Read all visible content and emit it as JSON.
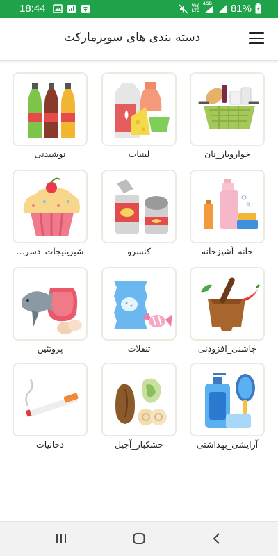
{
  "status_bar": {
    "time": "18:44",
    "battery": "81%",
    "left_icons": [
      "image-icon",
      "signal-icon",
      "wifi-icon"
    ],
    "right_icons": [
      "mute-icon",
      "volte-icon",
      "4g-signal-icon",
      "cell-signal-icon",
      "battery-icon"
    ],
    "network_top": "Vo))",
    "network_bottom": "LTE",
    "network_4g": "4.5G",
    "background_color": "#1fa34a"
  },
  "app_bar": {
    "title": "دسته بندی های سوپرمارکت",
    "menu_icon": "hamburger-menu-icon"
  },
  "categories": [
    {
      "label": "خواروبار_نان",
      "icon": "grocery-basket-icon"
    },
    {
      "label": "لبنیات",
      "icon": "dairy-icon"
    },
    {
      "label": "نوشیدنی",
      "icon": "drinks-icon"
    },
    {
      "label": "خانه_آشپزخانه",
      "icon": "cleaning-products-icon"
    },
    {
      "label": "کنسرو",
      "icon": "canned-food-icon"
    },
    {
      "label": "شیرینیجات_دسر...",
      "icon": "cupcake-icon"
    },
    {
      "label": "چاشنی_افزودنی",
      "icon": "mortar-spices-icon"
    },
    {
      "label": "تنقلات",
      "icon": "snacks-icon"
    },
    {
      "label": "پروتئین",
      "icon": "protein-icon"
    },
    {
      "label": "آرایشی_بهداشتی",
      "icon": "toiletries-icon"
    },
    {
      "label": "خشکبار_آجیل",
      "icon": "nuts-icon"
    },
    {
      "label": "دخانیات",
      "icon": "cigarette-icon"
    }
  ],
  "nav_bar": {
    "buttons": [
      "recent-apps-icon",
      "home-icon",
      "back-icon"
    ]
  }
}
